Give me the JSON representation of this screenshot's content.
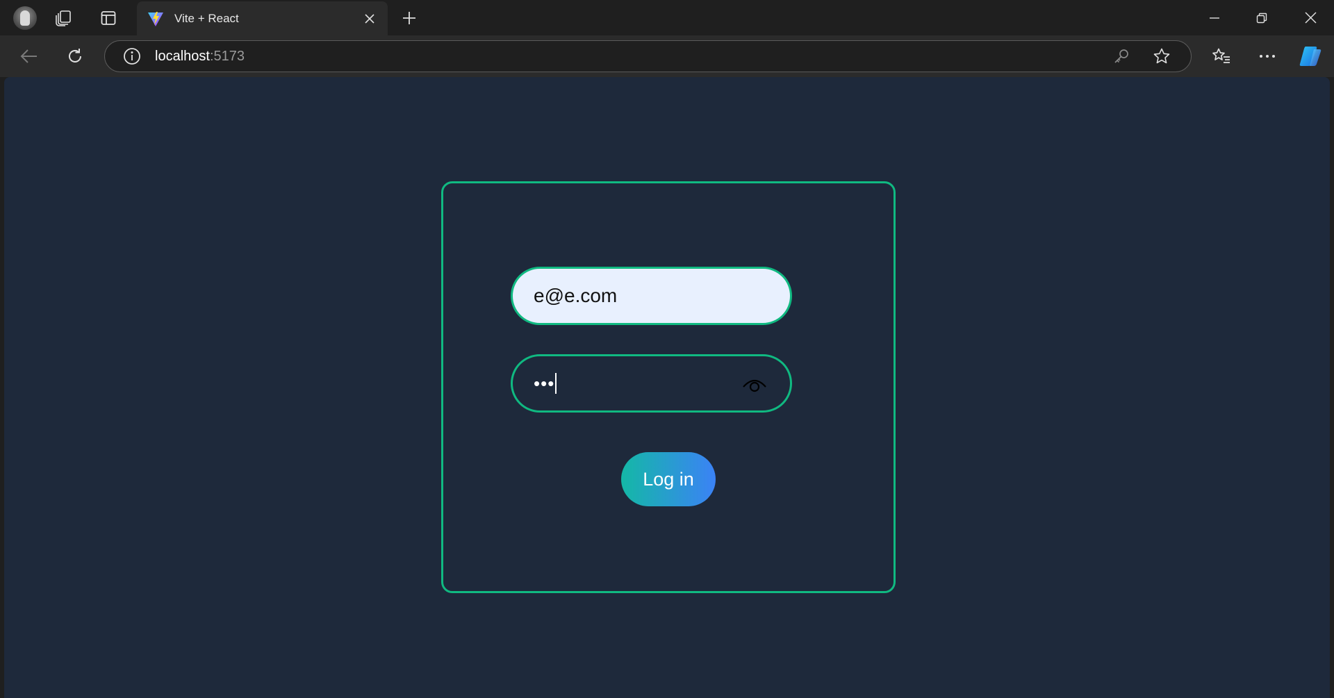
{
  "browser": {
    "tab": {
      "title": "Vite + React"
    },
    "address": {
      "host": "localhost",
      "port": ":5173"
    }
  },
  "login": {
    "email_value": "e@e.com",
    "password_mask": "•••",
    "submit_label": "Log in"
  },
  "colors": {
    "page_background": "#1e293b",
    "accent_border": "#10b981",
    "button_gradient_start": "#14b8a6",
    "button_gradient_end": "#3b82f6"
  },
  "icons": [
    "profile-avatar-icon",
    "workspaces-icon",
    "tab-actions-icon",
    "vite-favicon-icon",
    "close-icon",
    "plus-icon",
    "minimize-icon",
    "restore-icon",
    "back-icon",
    "reload-icon",
    "info-icon",
    "key-icon",
    "star-icon",
    "favorites-icon",
    "more-icon",
    "copilot-icon",
    "eye-icon"
  ]
}
